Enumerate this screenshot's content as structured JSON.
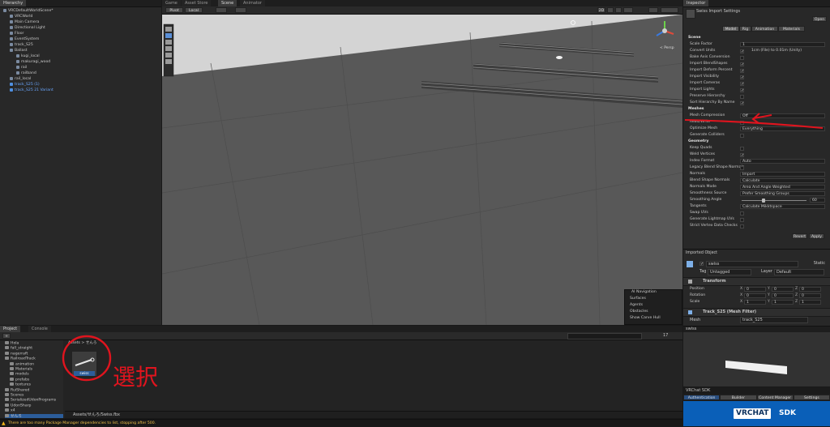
{
  "hierarchy": {
    "tab_label": "Hierarchy",
    "items": [
      {
        "label": "VRCDefaultWorldScene*",
        "indent": 0,
        "blue": false
      },
      {
        "label": "VRCWorld",
        "indent": 1,
        "blue": false
      },
      {
        "label": "Main Camera",
        "indent": 1,
        "blue": false
      },
      {
        "label": "Directional Light",
        "indent": 1,
        "blue": false
      },
      {
        "label": "Floor",
        "indent": 1,
        "blue": false
      },
      {
        "label": "EventSystem",
        "indent": 1,
        "blue": false
      },
      {
        "label": "track_S25",
        "indent": 1,
        "blue": false
      },
      {
        "label": "Ballast",
        "indent": 1,
        "blue": false
      },
      {
        "label": "kugi_local",
        "indent": 2,
        "blue": false
      },
      {
        "label": "makuragi_wood",
        "indent": 2,
        "blue": false
      },
      {
        "label": "rail",
        "indent": 2,
        "blue": false
      },
      {
        "label": "railband",
        "indent": 2,
        "blue": false
      },
      {
        "label": "rail_local",
        "indent": 1,
        "blue": false
      },
      {
        "label": "track_S25 (1)",
        "indent": 1,
        "blue": true
      },
      {
        "label": "track_S25 21 Variant",
        "indent": 1,
        "blue": true
      }
    ]
  },
  "scene_tabs": [
    {
      "label": "Game",
      "active": false
    },
    {
      "label": "Asset Store",
      "active": false
    },
    {
      "label": "Scene",
      "active": true
    },
    {
      "label": "Animator",
      "active": false
    }
  ],
  "scene_toolbar": {
    "pivot": "Pivot",
    "local": "Local",
    "mode_2d": "2D",
    "persp": "< Persp"
  },
  "ai_navigation": {
    "title": "AI Navigation",
    "items": [
      "Surfaces",
      "Agents",
      "Obstacles",
      "Show Carve Hull"
    ]
  },
  "inspector": {
    "tab_label": "Inspector",
    "title": "Swiss Import Settings",
    "open_button": "Open",
    "tabs": [
      {
        "label": "Model",
        "active": true
      },
      {
        "label": "Rig",
        "active": false
      },
      {
        "label": "Animation",
        "active": false
      },
      {
        "label": "Materials",
        "active": false
      }
    ],
    "rows": [
      {
        "type": "section",
        "label": "Scene"
      },
      {
        "type": "field",
        "label": "Scale Factor",
        "value": "1"
      },
      {
        "type": "check",
        "label": "Convert Units",
        "checked": true,
        "note": "1cm (File) to 0.01m (Unity)"
      },
      {
        "type": "check",
        "label": "Bake Axis Conversion",
        "checked": false
      },
      {
        "type": "check",
        "label": "Import BlendShapes",
        "checked": true
      },
      {
        "type": "check",
        "label": "Import Deform Percent",
        "checked": true
      },
      {
        "type": "check",
        "label": "Import Visibility",
        "checked": true
      },
      {
        "type": "check",
        "label": "Import Cameras",
        "checked": true
      },
      {
        "type": "check",
        "label": "Import Lights",
        "checked": true
      },
      {
        "type": "check",
        "label": "Preserve Hierarchy",
        "checked": false
      },
      {
        "type": "check",
        "label": "Sort Hierarchy By Name",
        "checked": true
      },
      {
        "type": "section",
        "label": "Meshes"
      },
      {
        "type": "field",
        "label": "Mesh Compression",
        "value": "Off"
      },
      {
        "type": "check",
        "label": "Read/Write",
        "checked": false
      },
      {
        "type": "field",
        "label": "Optimize Mesh",
        "value": "Everything"
      },
      {
        "type": "check",
        "label": "Generate Colliders",
        "checked": false
      },
      {
        "type": "section",
        "label": "Geometry"
      },
      {
        "type": "check",
        "label": "Keep Quads",
        "checked": false
      },
      {
        "type": "check",
        "label": "Weld Vertices",
        "checked": true
      },
      {
        "type": "field",
        "label": "Index Format",
        "value": "Auto"
      },
      {
        "type": "check",
        "label": "Legacy Blend Shape Normals",
        "checked": false
      },
      {
        "type": "field",
        "label": "Normals",
        "value": "Import"
      },
      {
        "type": "field",
        "label": "Blend Shape Normals",
        "value": "Calculate"
      },
      {
        "type": "field",
        "label": "Normals Mode",
        "value": "Area And Angle Weighted"
      },
      {
        "type": "field",
        "label": "Smoothness Source",
        "value": "Prefer Smoothing Groups"
      },
      {
        "type": "slider",
        "label": "Smoothing Angle",
        "value": "60"
      },
      {
        "type": "field",
        "label": "Tangents",
        "value": "Calculate Mikktspace"
      },
      {
        "type": "check",
        "label": "Swap UVs",
        "checked": false
      },
      {
        "type": "check",
        "label": "Generate Lightmap UVs",
        "checked": false
      },
      {
        "type": "check",
        "label": "Strict Vertex Data Checks",
        "checked": false
      }
    ],
    "revert": "Revert",
    "apply": "Apply",
    "imported_object": {
      "title": "Imported Object",
      "name": "swiss",
      "static": "Static",
      "tag_label": "Tag",
      "tag_value": "Untagged",
      "layer_label": "Layer",
      "layer_value": "Default",
      "transform_title": "Transform",
      "position_label": "Position",
      "rotation_label": "Rotation",
      "scale_label": "Scale",
      "position": [
        "0",
        "0",
        "0"
      ],
      "rotation": [
        "0",
        "0",
        "0"
      ],
      "scale": [
        "1",
        "1",
        "1"
      ],
      "mesh_filter_title": "Track_S25 (Mesh Filter)",
      "mesh_label": "Mesh",
      "mesh_value": "track_S25"
    },
    "preview_label": "swiss",
    "vrchat": {
      "title": "VRChat SDK",
      "tabs": [
        "Authentication",
        "Builder",
        "Content Manager",
        "Settings"
      ],
      "logo": "VRCHAT",
      "sdk": "SDK"
    }
  },
  "project": {
    "tabs": [
      {
        "label": "Project",
        "active": true
      },
      {
        "label": "Console",
        "active": false
      }
    ],
    "tree": [
      {
        "label": "Hola",
        "indent": 0
      },
      {
        "label": "fall_straight",
        "indent": 0
      },
      {
        "label": "nagerraft",
        "indent": 0
      },
      {
        "label": "RailroadTrack",
        "indent": 0
      },
      {
        "label": "animation",
        "indent": 1
      },
      {
        "label": "Materials",
        "indent": 1
      },
      {
        "label": "models",
        "indent": 1
      },
      {
        "label": "prefabs",
        "indent": 1
      },
      {
        "label": "textures",
        "indent": 1
      },
      {
        "label": "RuiShared",
        "indent": 0
      },
      {
        "label": "Scenes",
        "indent": 0
      },
      {
        "label": "SerializedUdonPrograms",
        "indent": 0
      },
      {
        "label": "UdonSharp",
        "indent": 0
      },
      {
        "label": "x4",
        "indent": 0
      },
      {
        "label": "せんろ",
        "indent": 0
      }
    ],
    "breadcrumb": [
      "Assets",
      "せんろ"
    ],
    "asset_label": "swiss",
    "path": "Assets/せんろ/Swiss.fbx",
    "count": "17"
  },
  "status_bar": {
    "message": "There are too many Package Manager dependencies to list, stopping after 500."
  },
  "annotation": {
    "text": "選択",
    "color": "#e0141e"
  }
}
